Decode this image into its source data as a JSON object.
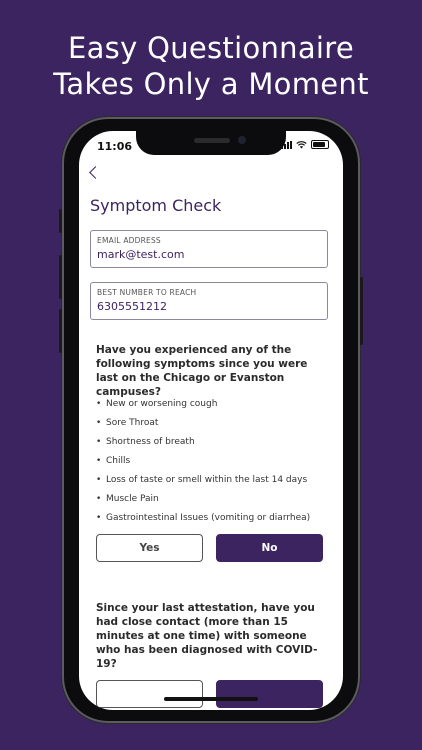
{
  "promo": {
    "line1": "Easy Questionnaire",
    "line2": "Takes Only a Moment"
  },
  "status_bar": {
    "time": "11:06"
  },
  "screen": {
    "title": "Symptom Check",
    "email": {
      "label": "EMAIL ADDRESS",
      "value": "mark@test.com"
    },
    "phone": {
      "label": "BEST NUMBER TO REACH",
      "value": "6305551212"
    },
    "question1": {
      "text": "Have you experienced any of the following symptoms since you were last on the Chicago or Evanston campuses?",
      "symptoms": [
        "New or worsening cough",
        "Sore Throat",
        "Shortness of breath",
        "Chills",
        "Loss of taste or smell within the last 14 days",
        "Muscle Pain",
        "Gastrointestinal Issues (vomiting or diarrhea)"
      ],
      "yes_label": "Yes",
      "no_label": "No",
      "selected": "No"
    },
    "question2": {
      "text": "Since your last attestation, have you had close contact (more than 15 minutes at one time) with someone who has been diagnosed with COVID-19?"
    }
  },
  "colors": {
    "brand": "#3c2461",
    "background": "#3c2461",
    "field_border": "#8d86a0"
  }
}
